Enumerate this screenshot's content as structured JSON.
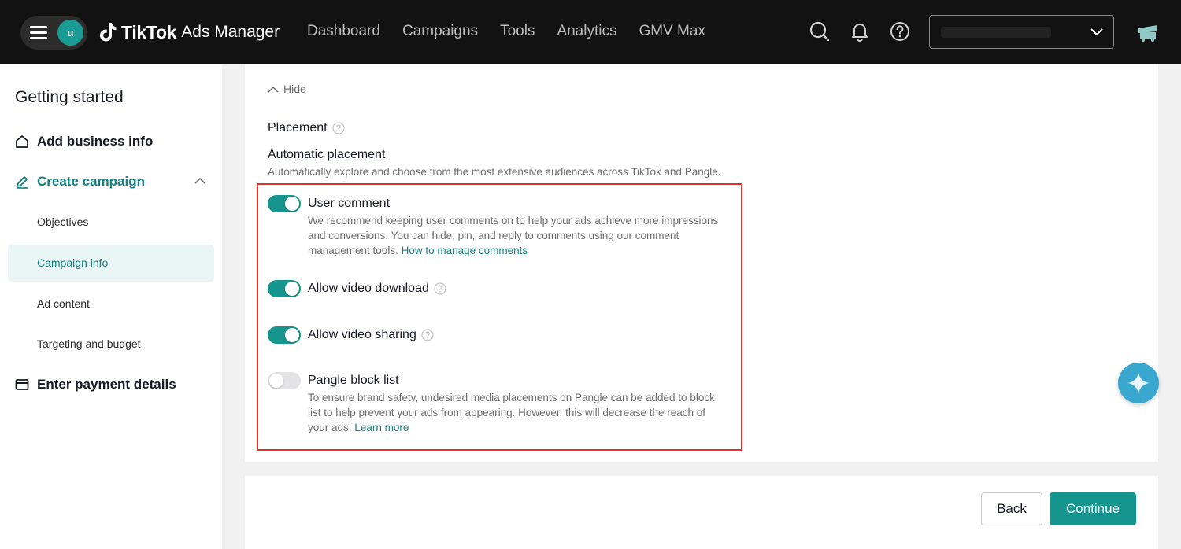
{
  "app": {
    "brand": "TikTok",
    "product": "Ads Manager",
    "avatar_initial": "u",
    "accent_color": "#16958f"
  },
  "nav": {
    "items": [
      "Dashboard",
      "Campaigns",
      "Tools",
      "Analytics",
      "GMV Max"
    ]
  },
  "topbar_icons": [
    "search-icon",
    "bell-icon",
    "help-icon",
    "cart-icon"
  ],
  "sidebar": {
    "title": "Getting started",
    "add_business": "Add business info",
    "create_campaign": "Create campaign",
    "subitems": [
      "Objectives",
      "Campaign info",
      "Ad content",
      "Targeting and budget"
    ],
    "active_subitem": "Campaign info",
    "payment": "Enter payment details"
  },
  "main": {
    "hide_label": "Hide",
    "placement_label": "Placement",
    "auto_title": "Automatic placement",
    "auto_desc": "Automatically explore and choose from the most extensive audiences across TikTok and Pangle.",
    "options": [
      {
        "label": "User comment",
        "enabled": true,
        "desc": "We recommend keeping user comments on to help your ads achieve more impressions and conversions. You can hide, pin, and reply to comments using our comment management tools.",
        "link": "How to manage comments"
      },
      {
        "label": "Allow video download",
        "enabled": true
      },
      {
        "label": "Allow video sharing",
        "enabled": true
      },
      {
        "label": "Pangle block list",
        "enabled": false,
        "desc": "To ensure brand safety, undesired media placements on Pangle can be added to block list to help prevent your ads from appearing. However, this will decrease the reach of your ads.",
        "link": "Learn more"
      }
    ]
  },
  "footer": {
    "back_label": "Back",
    "continue_label": "Continue"
  }
}
